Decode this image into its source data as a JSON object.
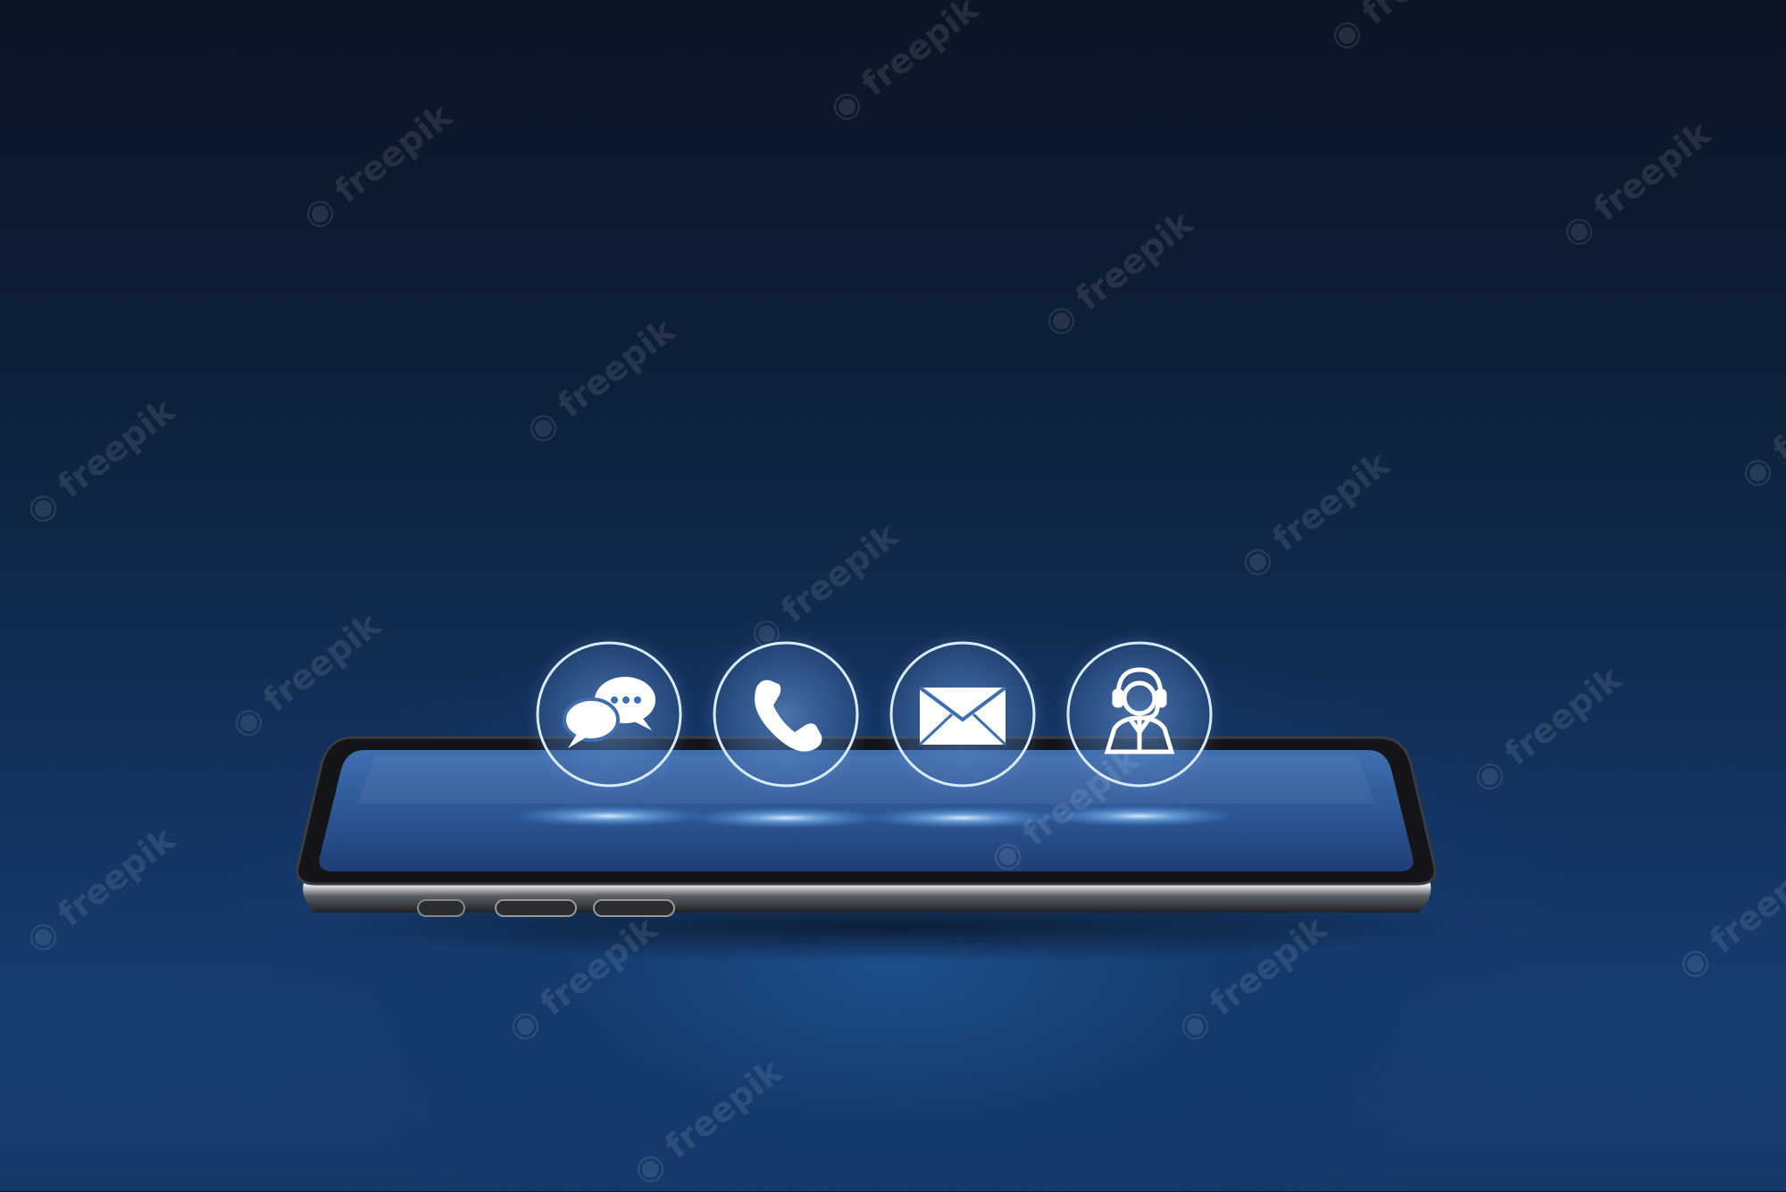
{
  "scene": {
    "background_top": "#0b1524",
    "background_bottom": "#173d70",
    "icon_glow": "#9fd0ff"
  },
  "phone": {
    "screen_color": "#2f5a9a",
    "frame_color": "#1a1a1c"
  },
  "contact_icons": [
    {
      "name": "chat-bubbles-icon"
    },
    {
      "name": "phone-handset-icon"
    },
    {
      "name": "envelope-icon"
    },
    {
      "name": "support-agent-headset-icon"
    }
  ],
  "watermark": {
    "text": "freepik"
  }
}
